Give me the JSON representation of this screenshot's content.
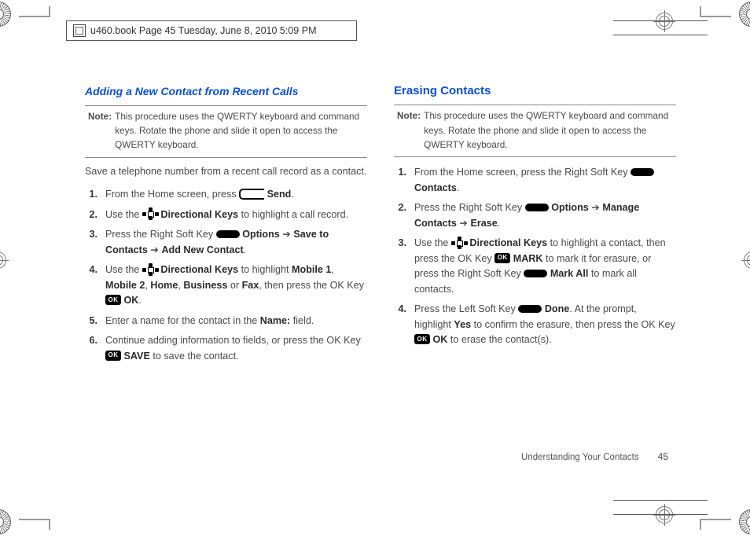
{
  "meta": {
    "strip": "u460.book  Page 45  Tuesday, June 8, 2010  5:09 PM"
  },
  "left": {
    "heading": "Adding a New Contact from Recent Calls",
    "note_label": "Note:",
    "note_text": "This procedure uses the QWERTY keyboard and command keys. Rotate the phone and slide it open to access the QWERTY keyboard.",
    "intro": "Save a telephone number from a recent call record as a contact.",
    "s1a": "From the Home screen, press ",
    "s1b": "Send",
    "s1c": ".",
    "s2a": "Use the ",
    "s2b": "Directional Keys",
    "s2c": " to highlight a call record.",
    "s3a": "Press the Right Soft Key ",
    "s3b": "Options",
    "s3arrow": " ➔ ",
    "s3c": "Save to Contacts",
    "s3d": "Add New Contact",
    "s3e": ".",
    "s4a": "Use the ",
    "s4b": "Directional Keys",
    "s4c": " to highlight ",
    "s4m1": "Mobile 1",
    "s4m2": "Mobile 2",
    "s4h": "Home",
    "s4bu": "Business",
    "s4or": " or ",
    "s4f": "Fax",
    "s4d": ", then press the OK Key ",
    "s4ok": "OK",
    "s4e": ".",
    "s5a": "Enter a name for the contact in the ",
    "s5b": "Name:",
    "s5c": " field.",
    "s6a": "Continue adding information to fields, or press the OK Key ",
    "s6b": "SAVE",
    "s6c": " to save the contact."
  },
  "right": {
    "heading": "Erasing Contacts",
    "note_label": "Note:",
    "note_text": "This procedure uses the QWERTY keyboard and command keys. Rotate the phone and slide it open to access the QWERTY keyboard.",
    "s1a": "From the Home screen, press the Right Soft Key ",
    "s1b": "Contacts",
    "s1c": ".",
    "s2a": "Press the Right Soft Key ",
    "s2b": "Options",
    "s2arrow": " ➔ ",
    "s2c": "Manage Contacts",
    "s2d": "Erase",
    "s2e": ".",
    "s3a": "Use the ",
    "s3b": "Directional Keys",
    "s3c": " to highlight a contact, then press the OK Key ",
    "s3d": "MARK",
    "s3e": "  to mark it for erasure, or press the Right Soft Key ",
    "s3f": "Mark All",
    "s3g": " to mark all contacts.",
    "s4a": "Press the Left Soft Key ",
    "s4b": "Done",
    "s4c": ". At the prompt, highlight ",
    "s4d": "Yes",
    "s4e": " to confirm the erasure, then press the OK Key ",
    "s4f": "OK",
    "s4g": " to erase the contact(s)."
  },
  "footer": {
    "section": "Understanding Your Contacts",
    "page": "45"
  },
  "nums": {
    "n1": "1.",
    "n2": "2.",
    "n3": "3.",
    "n4": "4.",
    "n5": "5.",
    "n6": "6."
  },
  "sep": {
    "comma": ", "
  }
}
